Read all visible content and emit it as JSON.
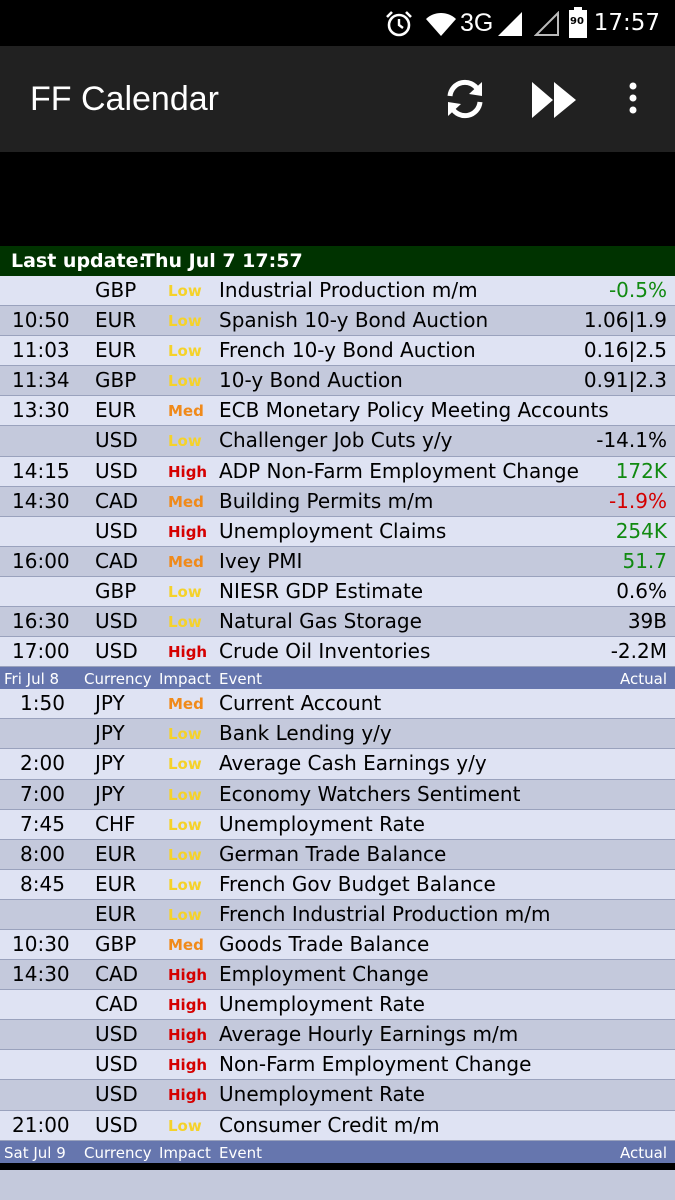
{
  "status_bar": {
    "time": "17:57",
    "network": "3G",
    "battery": "90",
    "icons": [
      "alarm-icon",
      "wifi-icon",
      "signal-icon",
      "signal-empty-icon",
      "battery-icon"
    ]
  },
  "app_bar": {
    "title": "FF Calendar",
    "actions": [
      "refresh-icon",
      "fast-forward-icon",
      "overflow-menu-icon"
    ]
  },
  "last_update": {
    "label": "Last update:",
    "value": "Thu Jul 7 17:57"
  },
  "colors": {
    "low": "#f5d22a",
    "med": "#f08a1a",
    "high": "#d50000",
    "positive": "#118a11",
    "negative": "#d40000",
    "header_bg": "#6676ae",
    "update_bg": "#003300"
  },
  "columns": {
    "currency": "Currency",
    "impact": "Impact",
    "event": "Event",
    "actual": "Actual"
  },
  "days": [
    {
      "header": null,
      "events": [
        {
          "time": "",
          "currency": "GBP",
          "impact": "Low",
          "event": "Industrial Production m/m",
          "actual": "-0.5%",
          "actual_color": "green"
        },
        {
          "time": "10:50",
          "currency": "EUR",
          "impact": "Low",
          "event": "Spanish 10-y Bond Auction",
          "actual": "1.06|1.9",
          "actual_color": "black"
        },
        {
          "time": "11:03",
          "currency": "EUR",
          "impact": "Low",
          "event": "French 10-y Bond Auction",
          "actual": "0.16|2.5",
          "actual_color": "black"
        },
        {
          "time": "11:34",
          "currency": "GBP",
          "impact": "Low",
          "event": "10-y Bond Auction",
          "actual": "0.91|2.3",
          "actual_color": "black"
        },
        {
          "time": "13:30",
          "currency": "EUR",
          "impact": "Med",
          "event": "ECB Monetary Policy Meeting Accounts",
          "actual": "",
          "actual_color": "black"
        },
        {
          "time": "",
          "currency": "USD",
          "impact": "Low",
          "event": "Challenger Job Cuts y/y",
          "actual": "-14.1%",
          "actual_color": "black"
        },
        {
          "time": "14:15",
          "currency": "USD",
          "impact": "High",
          "event": "ADP Non-Farm Employment Change",
          "actual": "172K",
          "actual_color": "green"
        },
        {
          "time": "14:30",
          "currency": "CAD",
          "impact": "Med",
          "event": "Building Permits m/m",
          "actual": "-1.9%",
          "actual_color": "red"
        },
        {
          "time": "",
          "currency": "USD",
          "impact": "High",
          "event": "Unemployment Claims",
          "actual": "254K",
          "actual_color": "green"
        },
        {
          "time": "16:00",
          "currency": "CAD",
          "impact": "Med",
          "event": "Ivey PMI",
          "actual": "51.7",
          "actual_color": "green"
        },
        {
          "time": "",
          "currency": "GBP",
          "impact": "Low",
          "event": "NIESR GDP Estimate",
          "actual": "0.6%",
          "actual_color": "black"
        },
        {
          "time": "16:30",
          "currency": "USD",
          "impact": "Low",
          "event": "Natural Gas Storage",
          "actual": "39B",
          "actual_color": "black"
        },
        {
          "time": "17:00",
          "currency": "USD",
          "impact": "High",
          "event": "Crude Oil Inventories",
          "actual": "-2.2M",
          "actual_color": "black"
        }
      ]
    },
    {
      "header": "Fri Jul 8",
      "events": [
        {
          "time": "1:50",
          "currency": "JPY",
          "impact": "Med",
          "event": "Current Account",
          "actual": "",
          "actual_color": "black"
        },
        {
          "time": "",
          "currency": "JPY",
          "impact": "Low",
          "event": "Bank Lending y/y",
          "actual": "",
          "actual_color": "black"
        },
        {
          "time": "2:00",
          "currency": "JPY",
          "impact": "Low",
          "event": "Average Cash Earnings y/y",
          "actual": "",
          "actual_color": "black"
        },
        {
          "time": "7:00",
          "currency": "JPY",
          "impact": "Low",
          "event": "Economy Watchers Sentiment",
          "actual": "",
          "actual_color": "black"
        },
        {
          "time": "7:45",
          "currency": "CHF",
          "impact": "Low",
          "event": "Unemployment Rate",
          "actual": "",
          "actual_color": "black"
        },
        {
          "time": "8:00",
          "currency": "EUR",
          "impact": "Low",
          "event": "German Trade Balance",
          "actual": "",
          "actual_color": "black"
        },
        {
          "time": "8:45",
          "currency": "EUR",
          "impact": "Low",
          "event": "French Gov Budget Balance",
          "actual": "",
          "actual_color": "black"
        },
        {
          "time": "",
          "currency": "EUR",
          "impact": "Low",
          "event": "French Industrial Production m/m",
          "actual": "",
          "actual_color": "black"
        },
        {
          "time": "10:30",
          "currency": "GBP",
          "impact": "Med",
          "event": "Goods Trade Balance",
          "actual": "",
          "actual_color": "black"
        },
        {
          "time": "14:30",
          "currency": "CAD",
          "impact": "High",
          "event": "Employment Change",
          "actual": "",
          "actual_color": "black"
        },
        {
          "time": "",
          "currency": "CAD",
          "impact": "High",
          "event": "Unemployment Rate",
          "actual": "",
          "actual_color": "black"
        },
        {
          "time": "",
          "currency": "USD",
          "impact": "High",
          "event": "Average Hourly Earnings m/m",
          "actual": "",
          "actual_color": "black"
        },
        {
          "time": "",
          "currency": "USD",
          "impact": "High",
          "event": "Non-Farm Employment Change",
          "actual": "",
          "actual_color": "black"
        },
        {
          "time": "",
          "currency": "USD",
          "impact": "High",
          "event": "Unemployment Rate",
          "actual": "",
          "actual_color": "black"
        },
        {
          "time": "21:00",
          "currency": "USD",
          "impact": "Low",
          "event": "Consumer Credit m/m",
          "actual": "",
          "actual_color": "black"
        }
      ]
    },
    {
      "header": "Sat Jul 9",
      "events": []
    }
  ]
}
